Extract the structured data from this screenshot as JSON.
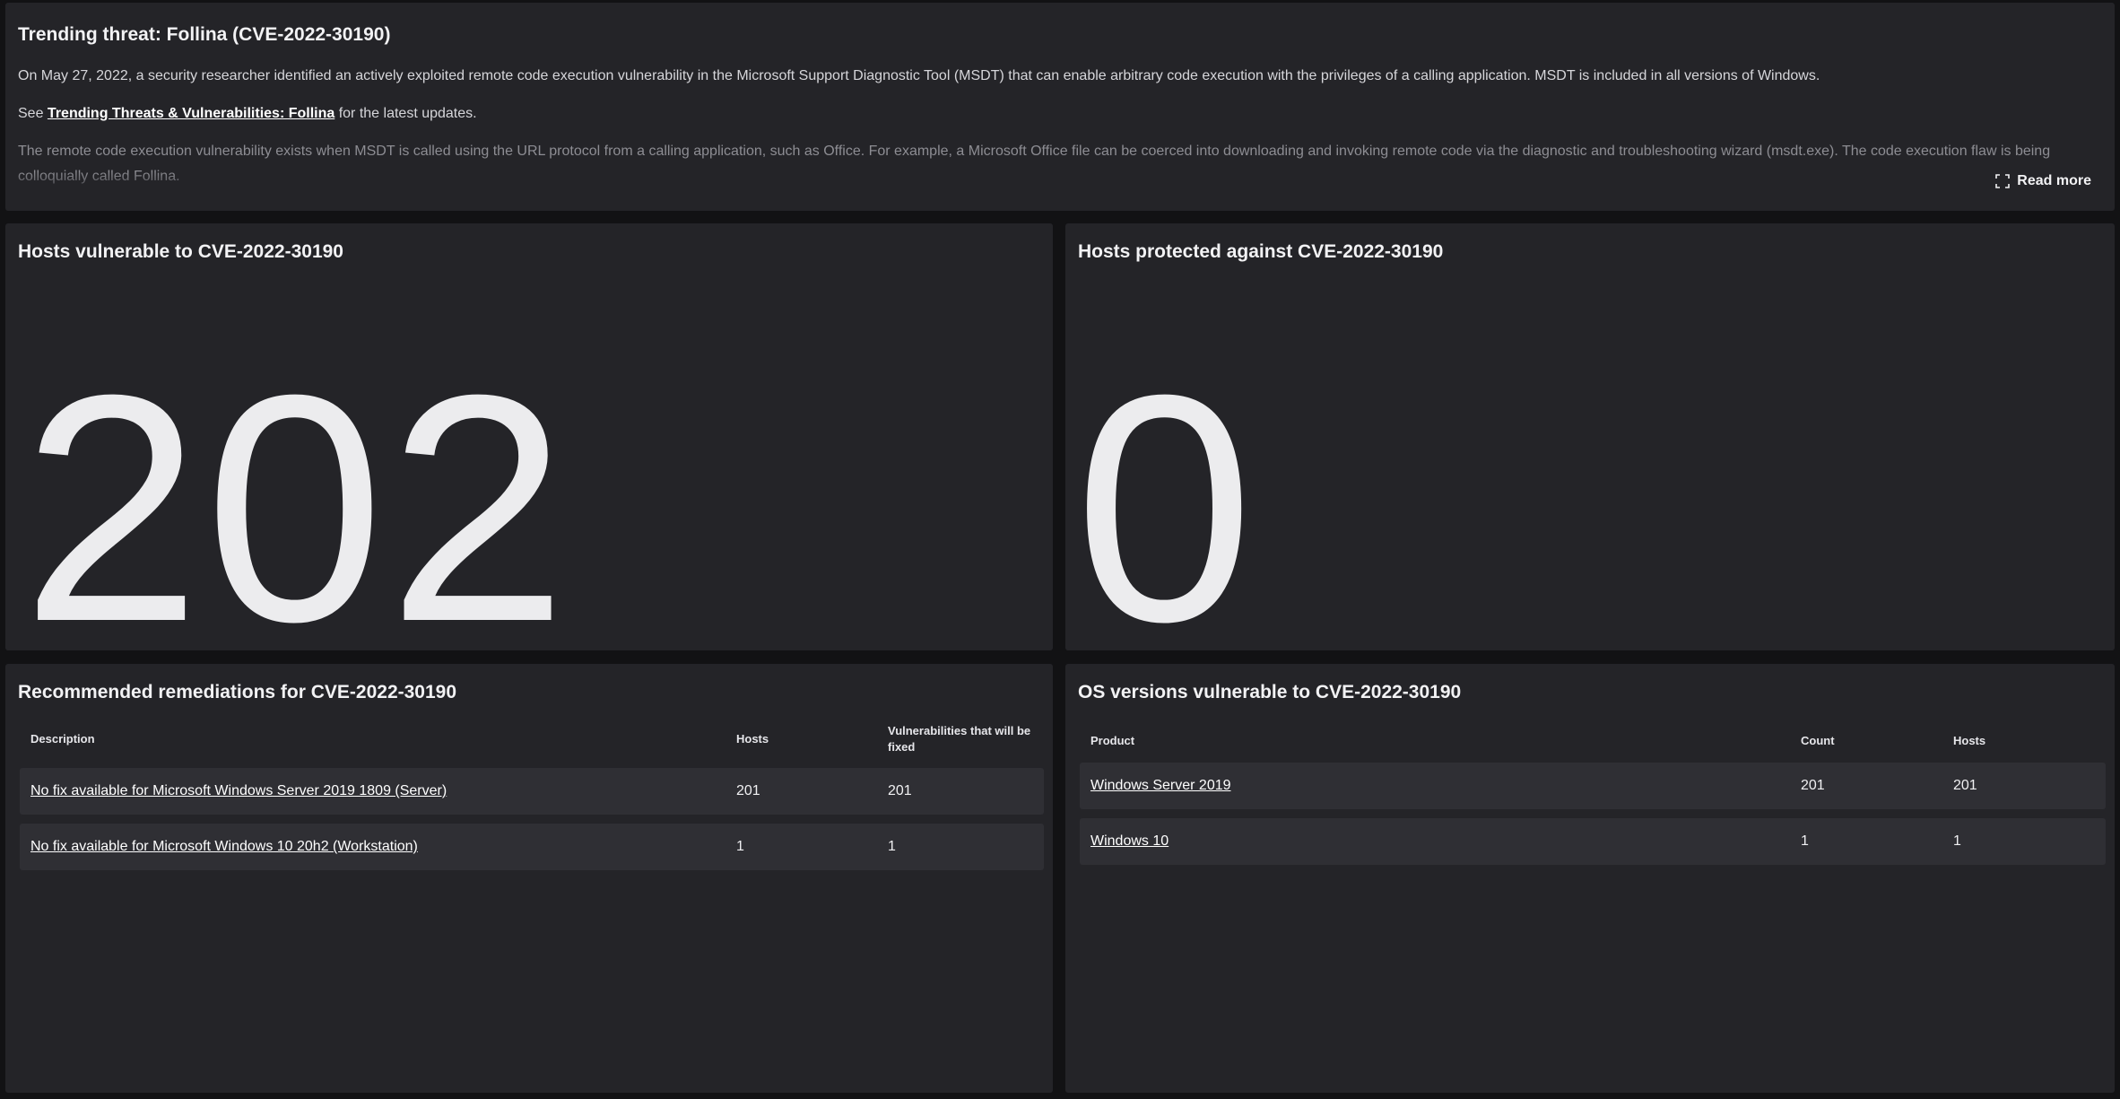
{
  "threat": {
    "title": "Trending threat: Follina (CVE-2022-30190)",
    "paragraph1": "On May 27, 2022, a security researcher identified an actively exploited remote code execution vulnerability in the Microsoft Support Diagnostic Tool (MSDT) that can enable arbitrary code execution with the privileges of a calling application. MSDT is included in all versions of Windows.",
    "paragraph2_prefix": "See ",
    "paragraph2_link": "Trending Threats & Vulnerabilities: Follina",
    "paragraph2_suffix": " for the latest updates.",
    "paragraph3": "The remote code execution vulnerability exists when MSDT is called using the URL protocol from a calling application, such as Office. For example, a Microsoft Office file can be coerced into downloading and invoking remote code via the diagnostic and troubleshooting wizard (msdt.exe). The code execution flaw is being colloquially called Follina.",
    "read_more_label": "Read more",
    "read_more_icon": "expand-icon"
  },
  "vulnerable": {
    "title": "Hosts vulnerable to CVE-2022-30190",
    "value": "202"
  },
  "protected": {
    "title": "Hosts protected against CVE-2022-30190",
    "value": "0"
  },
  "remediations": {
    "title": "Recommended remediations for CVE-2022-30190",
    "columns": [
      "Description",
      "Hosts",
      "Vulnerabilities that will be fixed"
    ],
    "rows": [
      {
        "description": "No fix available for Microsoft Windows Server 2019 1809 (Server)",
        "hosts": "201",
        "fixed": "201"
      },
      {
        "description": "No fix available for Microsoft Windows 10 20h2 (Workstation)",
        "hosts": "1",
        "fixed": "1"
      }
    ]
  },
  "os_versions": {
    "title": "OS versions vulnerable to CVE-2022-30190",
    "columns": [
      "Product",
      "Count",
      "Hosts"
    ],
    "rows": [
      {
        "product": "Windows Server 2019",
        "count": "201",
        "hosts": "201"
      },
      {
        "product": "Windows 10",
        "count": "1",
        "hosts": "1"
      }
    ]
  }
}
